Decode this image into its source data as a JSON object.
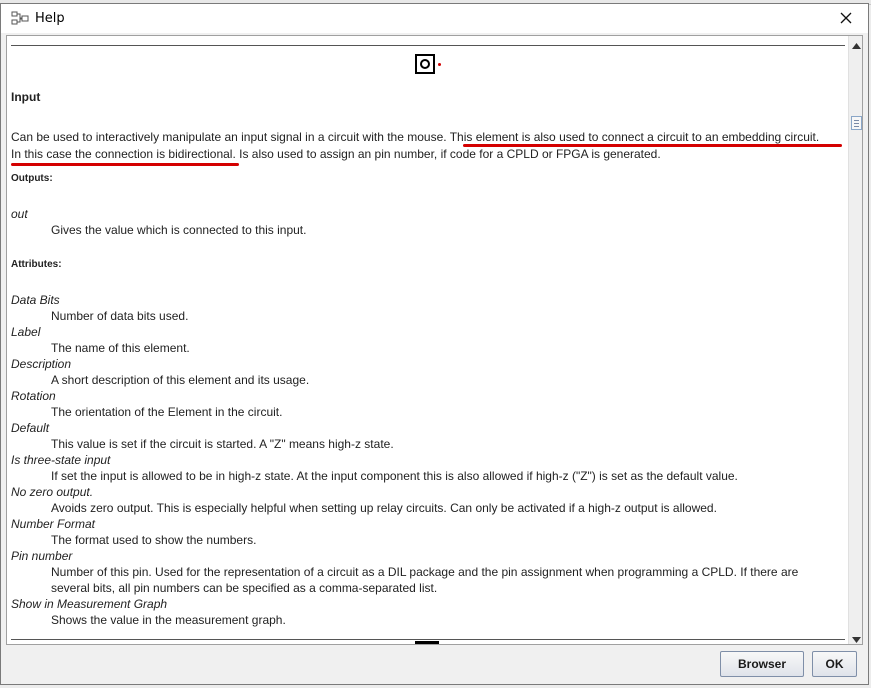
{
  "window": {
    "title": "Help"
  },
  "doc": {
    "heading": "Input",
    "description_line1": "Can be used to interactively manipulate an input signal in a circuit with the mouse. This element is also used to connect a circuit to an embedding circuit.",
    "description_line2": "In this case the connection is bidirectional. Is also used to assign an pin number, if code for a CPLD or FPGA is generated.",
    "outputs_label": "Outputs:",
    "outputs": [
      {
        "term": "out",
        "def": "Gives the value which is connected to this input."
      }
    ],
    "attributes_label": "Attributes:",
    "attributes": [
      {
        "term": "Data Bits",
        "def": "Number of data bits used."
      },
      {
        "term": "Label",
        "def": "The name of this element."
      },
      {
        "term": "Description",
        "def": "A short description of this element and its usage."
      },
      {
        "term": "Rotation",
        "def": "The orientation of the Element in the circuit."
      },
      {
        "term": "Default",
        "def": "This value is set if the circuit is started. A \"Z\" means high-z state."
      },
      {
        "term": "Is three-state input",
        "def": "If set the input is allowed to be in high-z state. At the input component this is also allowed if high-z (\"Z\") is set as the default value."
      },
      {
        "term": "No zero output.",
        "def": "Avoids zero output. This is especially helpful when setting up relay circuits. Can only be activated if a high-z output is allowed."
      },
      {
        "term": "Number Format",
        "def": "The format used to show the numbers."
      },
      {
        "term": "Pin number",
        "def": "Number of this pin. Used for the representation of a circuit as a DIL package and the pin assignment when programming a CPLD. If there are",
        "def2": "several bits, all pin numbers can be specified as a comma-separated list."
      },
      {
        "term": "Show in Measurement Graph",
        "def": "Shows the value in the measurement graph."
      }
    ]
  },
  "buttons": {
    "browser": "Browser",
    "ok": "OK"
  },
  "colors": {
    "annotation_red": "#d40000"
  }
}
